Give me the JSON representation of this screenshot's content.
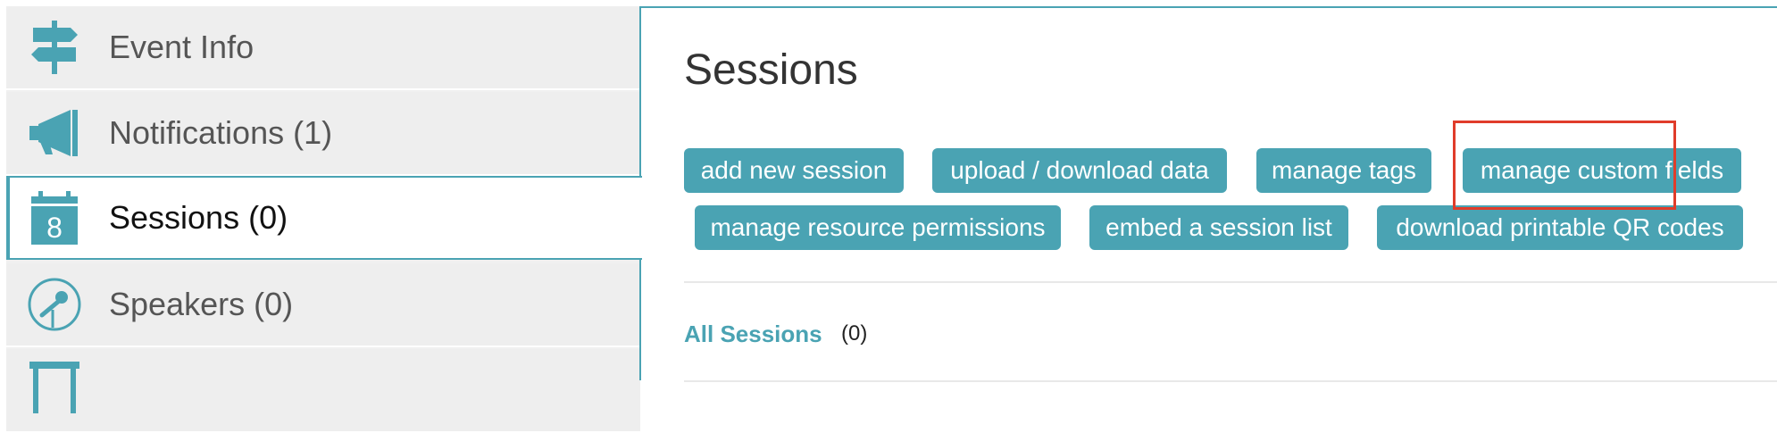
{
  "sidebar": {
    "items": [
      {
        "label": "Event Info",
        "icon": "signpost-icon"
      },
      {
        "label": "Notifications (1)",
        "icon": "megaphone-icon"
      },
      {
        "label": "Sessions (0)",
        "icon": "calendar-icon",
        "icon_text": "8",
        "active": true
      },
      {
        "label": "Speakers (0)",
        "icon": "microphone-icon"
      },
      {
        "label": "",
        "icon": "exhibitor-booth-icon"
      }
    ]
  },
  "main": {
    "title": "Sessions",
    "buttons": [
      "add new session",
      "upload / download data",
      "manage tags",
      "manage custom fields",
      "manage resource permissions",
      "embed a session list",
      "download printable QR codes"
    ],
    "highlighted_button": "manage custom fields",
    "filter": {
      "label": "All Sessions",
      "count": "(0)"
    }
  },
  "colors": {
    "accent": "#4aa3b3",
    "highlight": "#e03c2a",
    "sidebar_bg": "#eeeeee"
  }
}
